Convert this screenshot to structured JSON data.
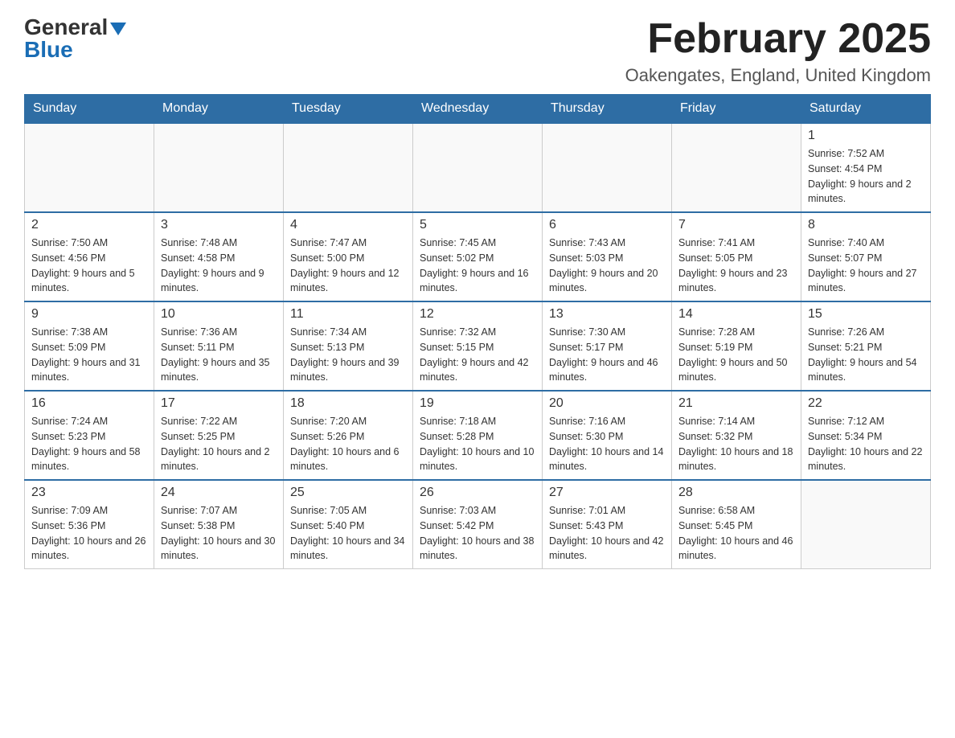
{
  "header": {
    "logo_general": "General",
    "logo_blue": "Blue",
    "month_title": "February 2025",
    "location": "Oakengates, England, United Kingdom"
  },
  "weekdays": [
    "Sunday",
    "Monday",
    "Tuesday",
    "Wednesday",
    "Thursday",
    "Friday",
    "Saturday"
  ],
  "weeks": [
    [
      {
        "day": "",
        "info": ""
      },
      {
        "day": "",
        "info": ""
      },
      {
        "day": "",
        "info": ""
      },
      {
        "day": "",
        "info": ""
      },
      {
        "day": "",
        "info": ""
      },
      {
        "day": "",
        "info": ""
      },
      {
        "day": "1",
        "info": "Sunrise: 7:52 AM\nSunset: 4:54 PM\nDaylight: 9 hours and 2 minutes."
      }
    ],
    [
      {
        "day": "2",
        "info": "Sunrise: 7:50 AM\nSunset: 4:56 PM\nDaylight: 9 hours and 5 minutes."
      },
      {
        "day": "3",
        "info": "Sunrise: 7:48 AM\nSunset: 4:58 PM\nDaylight: 9 hours and 9 minutes."
      },
      {
        "day": "4",
        "info": "Sunrise: 7:47 AM\nSunset: 5:00 PM\nDaylight: 9 hours and 12 minutes."
      },
      {
        "day": "5",
        "info": "Sunrise: 7:45 AM\nSunset: 5:02 PM\nDaylight: 9 hours and 16 minutes."
      },
      {
        "day": "6",
        "info": "Sunrise: 7:43 AM\nSunset: 5:03 PM\nDaylight: 9 hours and 20 minutes."
      },
      {
        "day": "7",
        "info": "Sunrise: 7:41 AM\nSunset: 5:05 PM\nDaylight: 9 hours and 23 minutes."
      },
      {
        "day": "8",
        "info": "Sunrise: 7:40 AM\nSunset: 5:07 PM\nDaylight: 9 hours and 27 minutes."
      }
    ],
    [
      {
        "day": "9",
        "info": "Sunrise: 7:38 AM\nSunset: 5:09 PM\nDaylight: 9 hours and 31 minutes."
      },
      {
        "day": "10",
        "info": "Sunrise: 7:36 AM\nSunset: 5:11 PM\nDaylight: 9 hours and 35 minutes."
      },
      {
        "day": "11",
        "info": "Sunrise: 7:34 AM\nSunset: 5:13 PM\nDaylight: 9 hours and 39 minutes."
      },
      {
        "day": "12",
        "info": "Sunrise: 7:32 AM\nSunset: 5:15 PM\nDaylight: 9 hours and 42 minutes."
      },
      {
        "day": "13",
        "info": "Sunrise: 7:30 AM\nSunset: 5:17 PM\nDaylight: 9 hours and 46 minutes."
      },
      {
        "day": "14",
        "info": "Sunrise: 7:28 AM\nSunset: 5:19 PM\nDaylight: 9 hours and 50 minutes."
      },
      {
        "day": "15",
        "info": "Sunrise: 7:26 AM\nSunset: 5:21 PM\nDaylight: 9 hours and 54 minutes."
      }
    ],
    [
      {
        "day": "16",
        "info": "Sunrise: 7:24 AM\nSunset: 5:23 PM\nDaylight: 9 hours and 58 minutes."
      },
      {
        "day": "17",
        "info": "Sunrise: 7:22 AM\nSunset: 5:25 PM\nDaylight: 10 hours and 2 minutes."
      },
      {
        "day": "18",
        "info": "Sunrise: 7:20 AM\nSunset: 5:26 PM\nDaylight: 10 hours and 6 minutes."
      },
      {
        "day": "19",
        "info": "Sunrise: 7:18 AM\nSunset: 5:28 PM\nDaylight: 10 hours and 10 minutes."
      },
      {
        "day": "20",
        "info": "Sunrise: 7:16 AM\nSunset: 5:30 PM\nDaylight: 10 hours and 14 minutes."
      },
      {
        "day": "21",
        "info": "Sunrise: 7:14 AM\nSunset: 5:32 PM\nDaylight: 10 hours and 18 minutes."
      },
      {
        "day": "22",
        "info": "Sunrise: 7:12 AM\nSunset: 5:34 PM\nDaylight: 10 hours and 22 minutes."
      }
    ],
    [
      {
        "day": "23",
        "info": "Sunrise: 7:09 AM\nSunset: 5:36 PM\nDaylight: 10 hours and 26 minutes."
      },
      {
        "day": "24",
        "info": "Sunrise: 7:07 AM\nSunset: 5:38 PM\nDaylight: 10 hours and 30 minutes."
      },
      {
        "day": "25",
        "info": "Sunrise: 7:05 AM\nSunset: 5:40 PM\nDaylight: 10 hours and 34 minutes."
      },
      {
        "day": "26",
        "info": "Sunrise: 7:03 AM\nSunset: 5:42 PM\nDaylight: 10 hours and 38 minutes."
      },
      {
        "day": "27",
        "info": "Sunrise: 7:01 AM\nSunset: 5:43 PM\nDaylight: 10 hours and 42 minutes."
      },
      {
        "day": "28",
        "info": "Sunrise: 6:58 AM\nSunset: 5:45 PM\nDaylight: 10 hours and 46 minutes."
      },
      {
        "day": "",
        "info": ""
      }
    ]
  ]
}
